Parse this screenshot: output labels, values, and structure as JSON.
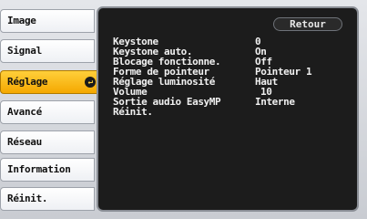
{
  "menu": {
    "items": [
      {
        "label": "Image",
        "active": false
      },
      {
        "label": "Signal",
        "active": false
      },
      {
        "label": "Réglage",
        "active": true
      },
      {
        "label": "Avancé",
        "active": false
      },
      {
        "label": "Réseau",
        "active": false
      },
      {
        "label": "Information",
        "active": false
      },
      {
        "label": "Réinit.",
        "active": false
      }
    ]
  },
  "panel": {
    "return_label": "Retour",
    "settings": [
      {
        "label": "Keystone",
        "value": "0"
      },
      {
        "label": "Keystone auto.",
        "value": "On"
      },
      {
        "label": "Blocage fonctionne.",
        "value": "Off"
      },
      {
        "label": "Forme de pointeur",
        "value": "Pointeur 1"
      },
      {
        "label": "Réglage luminosité",
        "value": "Haut"
      },
      {
        "label": "Volume",
        "value": "10"
      },
      {
        "label": "Sortie audio EasyMP",
        "value": "Interne"
      },
      {
        "label": "Réinit.",
        "value": ""
      }
    ]
  },
  "colors": {
    "active_tab": "#f5a800",
    "panel_bg": "#1c1c1c",
    "frame_bg": "#d6d9de"
  }
}
